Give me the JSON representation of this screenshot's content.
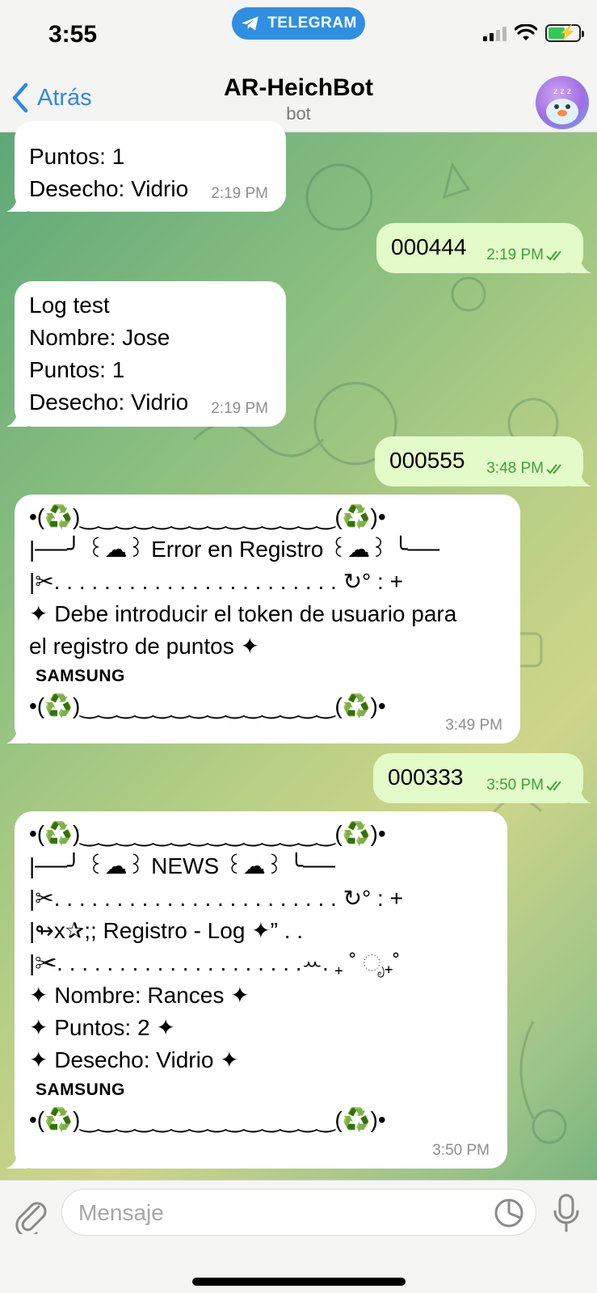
{
  "status_bar": {
    "time": "3:55",
    "app_pill": "TELEGRAM"
  },
  "header": {
    "back_label": "Atrás",
    "title": "AR-HeichBot",
    "subtitle": "bot"
  },
  "messages": [
    {
      "lines": [
        "Puntos: 1",
        "Desecho: Vidrio"
      ],
      "time": "2:19 PM"
    },
    {
      "text": "000444",
      "time": "2:19 PM"
    },
    {
      "lines": [
        "Log test",
        "Nombre: Jose",
        "Puntos: 1",
        "Desecho: Vidrio"
      ],
      "time": "2:19 PM"
    },
    {
      "text": "000555",
      "time": "3:48 PM"
    },
    {
      "border_top": "•(♻️)‿‿‿‿‿‿‿‿‿‿‿‿‿‿(♻️)•",
      "line1": "|──╯ ꒰☁︎꒱ Error en Registro ꒰☁︎꒱ ╰──",
      "line2": "|✂. . . . . . . . . . . . . . . . . . . . . . . ↻° : +",
      "line3": "✦ Debe introducir el token de usuario para",
      "line4": "el registro de puntos ✦",
      "brand": "SAMSUNG",
      "border_bottom": "•(♻️)‿‿‿‿‿‿‿‿‿‿‿‿‿‿(♻️)•",
      "time": "3:49 PM"
    },
    {
      "text": "000333",
      "time": "3:50 PM"
    },
    {
      "border_top": "•(♻️)‿‿‿‿‿‿‿‿‿‿‿‿‿‿(♻️)•",
      "line1": "|──╯ ꒰☁︎꒱ NEWS ꒰☁︎꒱ ╰──",
      "line2": "|✂. . . . . . . . . . . . . . . . . . . . . . . ↻° : +",
      "line3": "|↬x✰;; Registro - Log ✦” . .",
      "line4": "|✂. . . . . . . . . . . . . . . . . . . .ꕀ. ₊ ˚ ೃ₊˚",
      "line5": "✦ Nombre: Rances ✦",
      "line6": "✦ Puntos: 2 ✦",
      "line7": "✦ Desecho: Vidrio ✦",
      "brand": "SAMSUNG",
      "border_bottom": "•(♻️)‿‿‿‿‿‿‿‿‿‿‿‿‿‿(♻️)•",
      "time": "3:50 PM"
    }
  ],
  "composer": {
    "placeholder": "Mensaje"
  },
  "colors": {
    "accent": "#2f87e6",
    "outgoing_bubble": "#e3fbc8",
    "read_check": "#3fa23b"
  },
  "icons": [
    "telegram-icon",
    "signal-icon",
    "wifi-icon",
    "battery-icon",
    "back-chevron-icon",
    "attach-icon",
    "sticker-icon",
    "mic-icon",
    "double-check-icon"
  ]
}
